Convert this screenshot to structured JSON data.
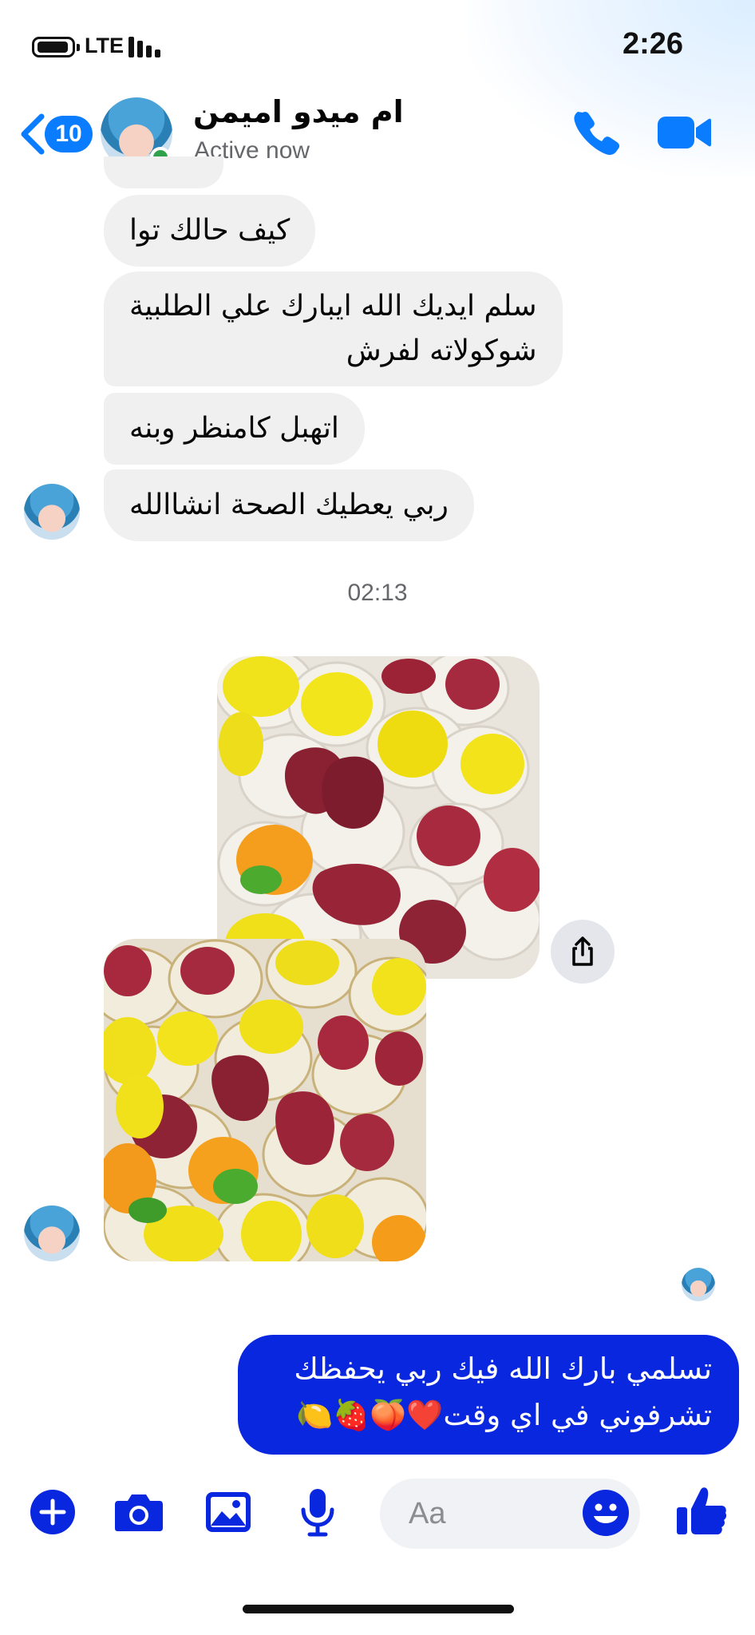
{
  "status_bar": {
    "time": "2:26",
    "carrier": "LTE"
  },
  "header": {
    "back_badge_count": "10",
    "contact_name": "ام ميدو اميمن",
    "status": "Active now",
    "accent_color": "#0a7cff",
    "icons": [
      "back-chevron-icon",
      "phone-icon",
      "video-camera-icon"
    ]
  },
  "messages": {
    "incoming": [
      {
        "text": "كيف حالك توا"
      },
      {
        "lines": [
          "سلم ايديك الله ايبارك علي الطلبية",
          "شوكولاته لفرش"
        ]
      },
      {
        "text": "اتهبل كامنظر وبنه"
      },
      {
        "text": "ربي يعطيك الصحة انشاالله"
      }
    ],
    "timestamp": "02:13",
    "photos": [
      "chocolate-fruit-treats-photo",
      "chocolate-fruit-treats-photo"
    ],
    "outgoing": {
      "lines": [
        "تسلمي بارك الله فيك ربي يحفظك",
        "تشرفوني في اي وقت❤️🍑🍓🍋"
      ],
      "color": "#0a27e0"
    }
  },
  "composer": {
    "placeholder": "Aa",
    "icons": [
      "plus-icon",
      "camera-icon",
      "image-icon",
      "microphone-icon",
      "emoji-icon",
      "thumbs-up-icon"
    ],
    "accent_color": "#0a27e0"
  }
}
